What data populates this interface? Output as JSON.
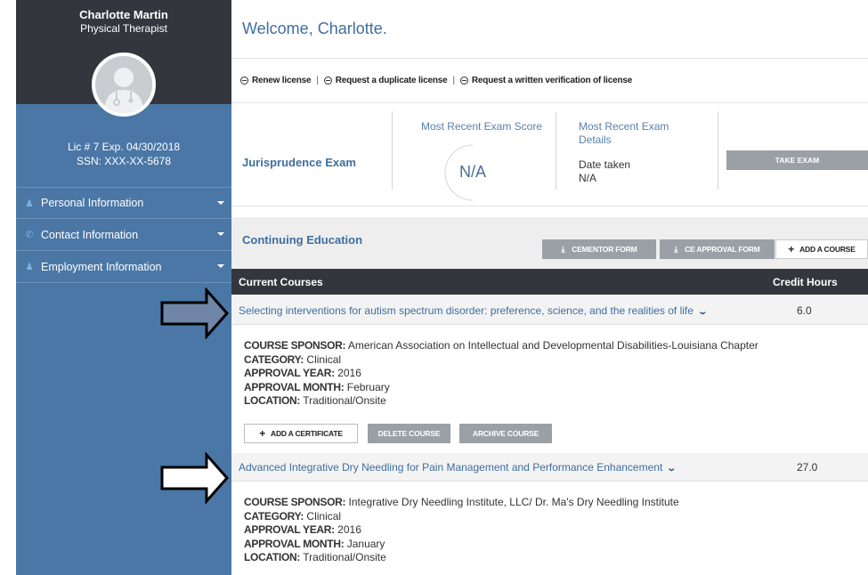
{
  "profile": {
    "name": "Charlotte Martin",
    "title": "Physical Therapist",
    "license": "Lic # 7 Exp. 04/30/2018",
    "ssn": "SSN: XXX-XX-5678"
  },
  "sidebar": {
    "items": [
      {
        "label": "Personal Information",
        "icon": "person-icon"
      },
      {
        "label": "Contact Information",
        "icon": "phone-icon"
      },
      {
        "label": "Employment Information",
        "icon": "person-icon"
      }
    ]
  },
  "welcome": "Welcome, Charlotte.",
  "license_actions": {
    "renew": "Renew license",
    "duplicate": "Request a duplicate license",
    "verification": "Request a written verification of license",
    "separator": "|"
  },
  "exam": {
    "title": "Jurisprudence Exam",
    "score_label": "Most Recent Exam Score",
    "score_value": "N/A",
    "details_label": "Most Recent Exam Details",
    "date_label": "Date taken",
    "date_value": "N/A",
    "take_exam": "TAKE EXAM"
  },
  "ce": {
    "title": "Continuing Education",
    "cementor": "CEMENTOR FORM",
    "ce_approval": "CE APPROVAL FORM",
    "add_course": "ADD A COURSE"
  },
  "courses_table": {
    "col_courses": "Current Courses",
    "col_credits": "Credit Hours"
  },
  "courses": [
    {
      "name": "Selecting interventions for autism spectrum disorder: preference, science, and the realities of life",
      "hours": "6.0",
      "sponsor_label": "COURSE SPONSOR:",
      "sponsor": "American Association on Intellectual and Developmental Disabilities-Louisiana Chapter",
      "category_label": "CATEGORY:",
      "category": "Clinical",
      "year_label": "APPROVAL YEAR:",
      "year": "2016",
      "month_label": "APPROVAL MONTH:",
      "month": "February",
      "location_label": "LOCATION:",
      "location": "Traditional/Onsite"
    },
    {
      "name": "Advanced Integrative Dry Needling for Pain Management and Performance Enhancement",
      "hours": "27.0",
      "sponsor_label": "COURSE SPONSOR:",
      "sponsor": "Integrative Dry Needling Institute, LLC/ Dr. Ma's Dry Needling Institute",
      "category_label": "CATEGORY:",
      "category": "Clinical",
      "year_label": "APPROVAL YEAR:",
      "year": "2016",
      "month_label": "APPROVAL MONTH:",
      "month": "January",
      "location_label": "LOCATION:",
      "location": "Traditional/Onsite"
    }
  ],
  "course_buttons": {
    "add_certificate": "ADD A CERTIFICATE",
    "delete_course": "DELETE COURSE",
    "archive_course": "ARCHIVE COURSE"
  },
  "colors": {
    "sidebar": "#4a77a6",
    "dark_header": "#33373d",
    "link_blue": "#3e6ea0",
    "button_gray": "#9aa0a6",
    "arrow_fill": "#6f86a8"
  }
}
